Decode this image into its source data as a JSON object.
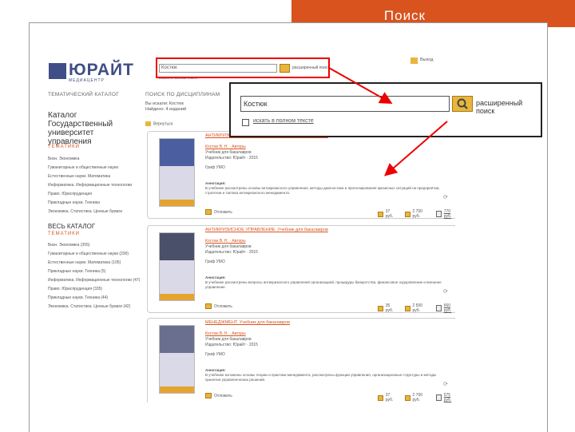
{
  "slide": {
    "title": "Поиск",
    "accent": "#d8531e"
  },
  "header": {
    "logo_text": "ЮРАЙТ",
    "logo_sub": "МЕДИАЦЕНТР",
    "search_value": "Костюк",
    "search_link": "расширенный поиск",
    "fulltext_label": "искать в полном тексте",
    "exit_label": "Выход"
  },
  "nav": {
    "tabs": [
      "ТЕМАТИЧЕСКИЙ КАТАЛОГ",
      "ПОИСК ПО ДИСЦИПЛИНАМ"
    ]
  },
  "sidebar": {
    "title": "Каталог Государственный университет управления",
    "sub1": "ТЕМАТИКИ",
    "items1": [
      "Бизн. Экономика",
      "Гуманитарные и общественные науки",
      "Естественные науки. Математика",
      "Информатика. Информационные технологии",
      "Право. Юриспруденция",
      "Прикладные науки. Техника",
      "Экономика. Статистика. Ценные бумаги"
    ],
    "heading2": "ВЕСЬ КАТАЛОГ",
    "sub2": "ТЕМАТИКИ",
    "items2": [
      "Бизн. Экономика (355)",
      "Гуманитарные и общественные науки (290)",
      "Естественные науки. Математика (105)",
      "Прикладные науки. Техника (5)",
      "Информатика. Информационные технологии (47)",
      "Право. Юриспруденция (335)",
      "Прикладные науки. Техника (44)",
      "Экономика. Статистика. Ценные бумаги (42)"
    ]
  },
  "center": {
    "info": [
      "Вы искали: Костюк",
      "Найдено: 4 изданий"
    ],
    "back_label": "Вернуться"
  },
  "books": [
    {
      "title": "АНТИКРИЗИСНОЕ УПРАВЛЕНИЕ. Учебник для бакалавров",
      "author_line": "Костюк В. Н. · Авторы",
      "type": "Учебник для бакалавров",
      "publisher": "Издательство: Юрайт · 2015",
      "grif": "Гриф УМО",
      "annotation_label": "Аннотация:",
      "annotation": "В учебнике рассмотрены основы антикризисного управления, методы диагностики и прогнозирования кризисных ситуаций на предприятии, стратегии и тактика антикризисного менеджмента.",
      "add_label": "Отложить",
      "prices": [
        "37 руб.",
        "2 700 руб.",
        "770 руб."
      ]
    },
    {
      "title": "АНТИКРИЗИСНОЕ УПРАВЛЕНИЕ. Учебник для бакалавров",
      "author_line": "Костюк В. Н. · Авторы",
      "type": "Учебник для бакалавров",
      "publisher": "Издательство: Юрайт · 2015",
      "grif": "Гриф УМО",
      "annotation_label": "Аннотация:",
      "annotation": "В учебнике рассмотрены вопросы антикризисного управления организацией, процедуры банкротства, финансовое оздоровление и внешнее управление.",
      "add_label": "Отложить",
      "prices": [
        "35 руб.",
        "2 500 руб.",
        "660 руб."
      ]
    },
    {
      "title": "МЕНЕДЖМЕНТ. Учебник для бакалавров",
      "author_line": "Костюк В. Н. · Авторы",
      "type": "Учебник для бакалавров",
      "publisher": "Издательство: Юрайт · 2015",
      "grif": "Гриф УМО",
      "annotation_label": "Аннотация:",
      "annotation": "В учебнике изложены основы теории и практики менеджмента, рассмотрены функции управления, организационные структуры и методы принятия управленческих решений.",
      "add_label": "Отложить",
      "prices": [
        "37 руб.",
        "2 700 руб.",
        "575 руб."
      ]
    }
  ],
  "zoom": {
    "search_value": "Костюк",
    "link": "расширенный поиск",
    "checkbox_label": "искать в полном тексте"
  }
}
